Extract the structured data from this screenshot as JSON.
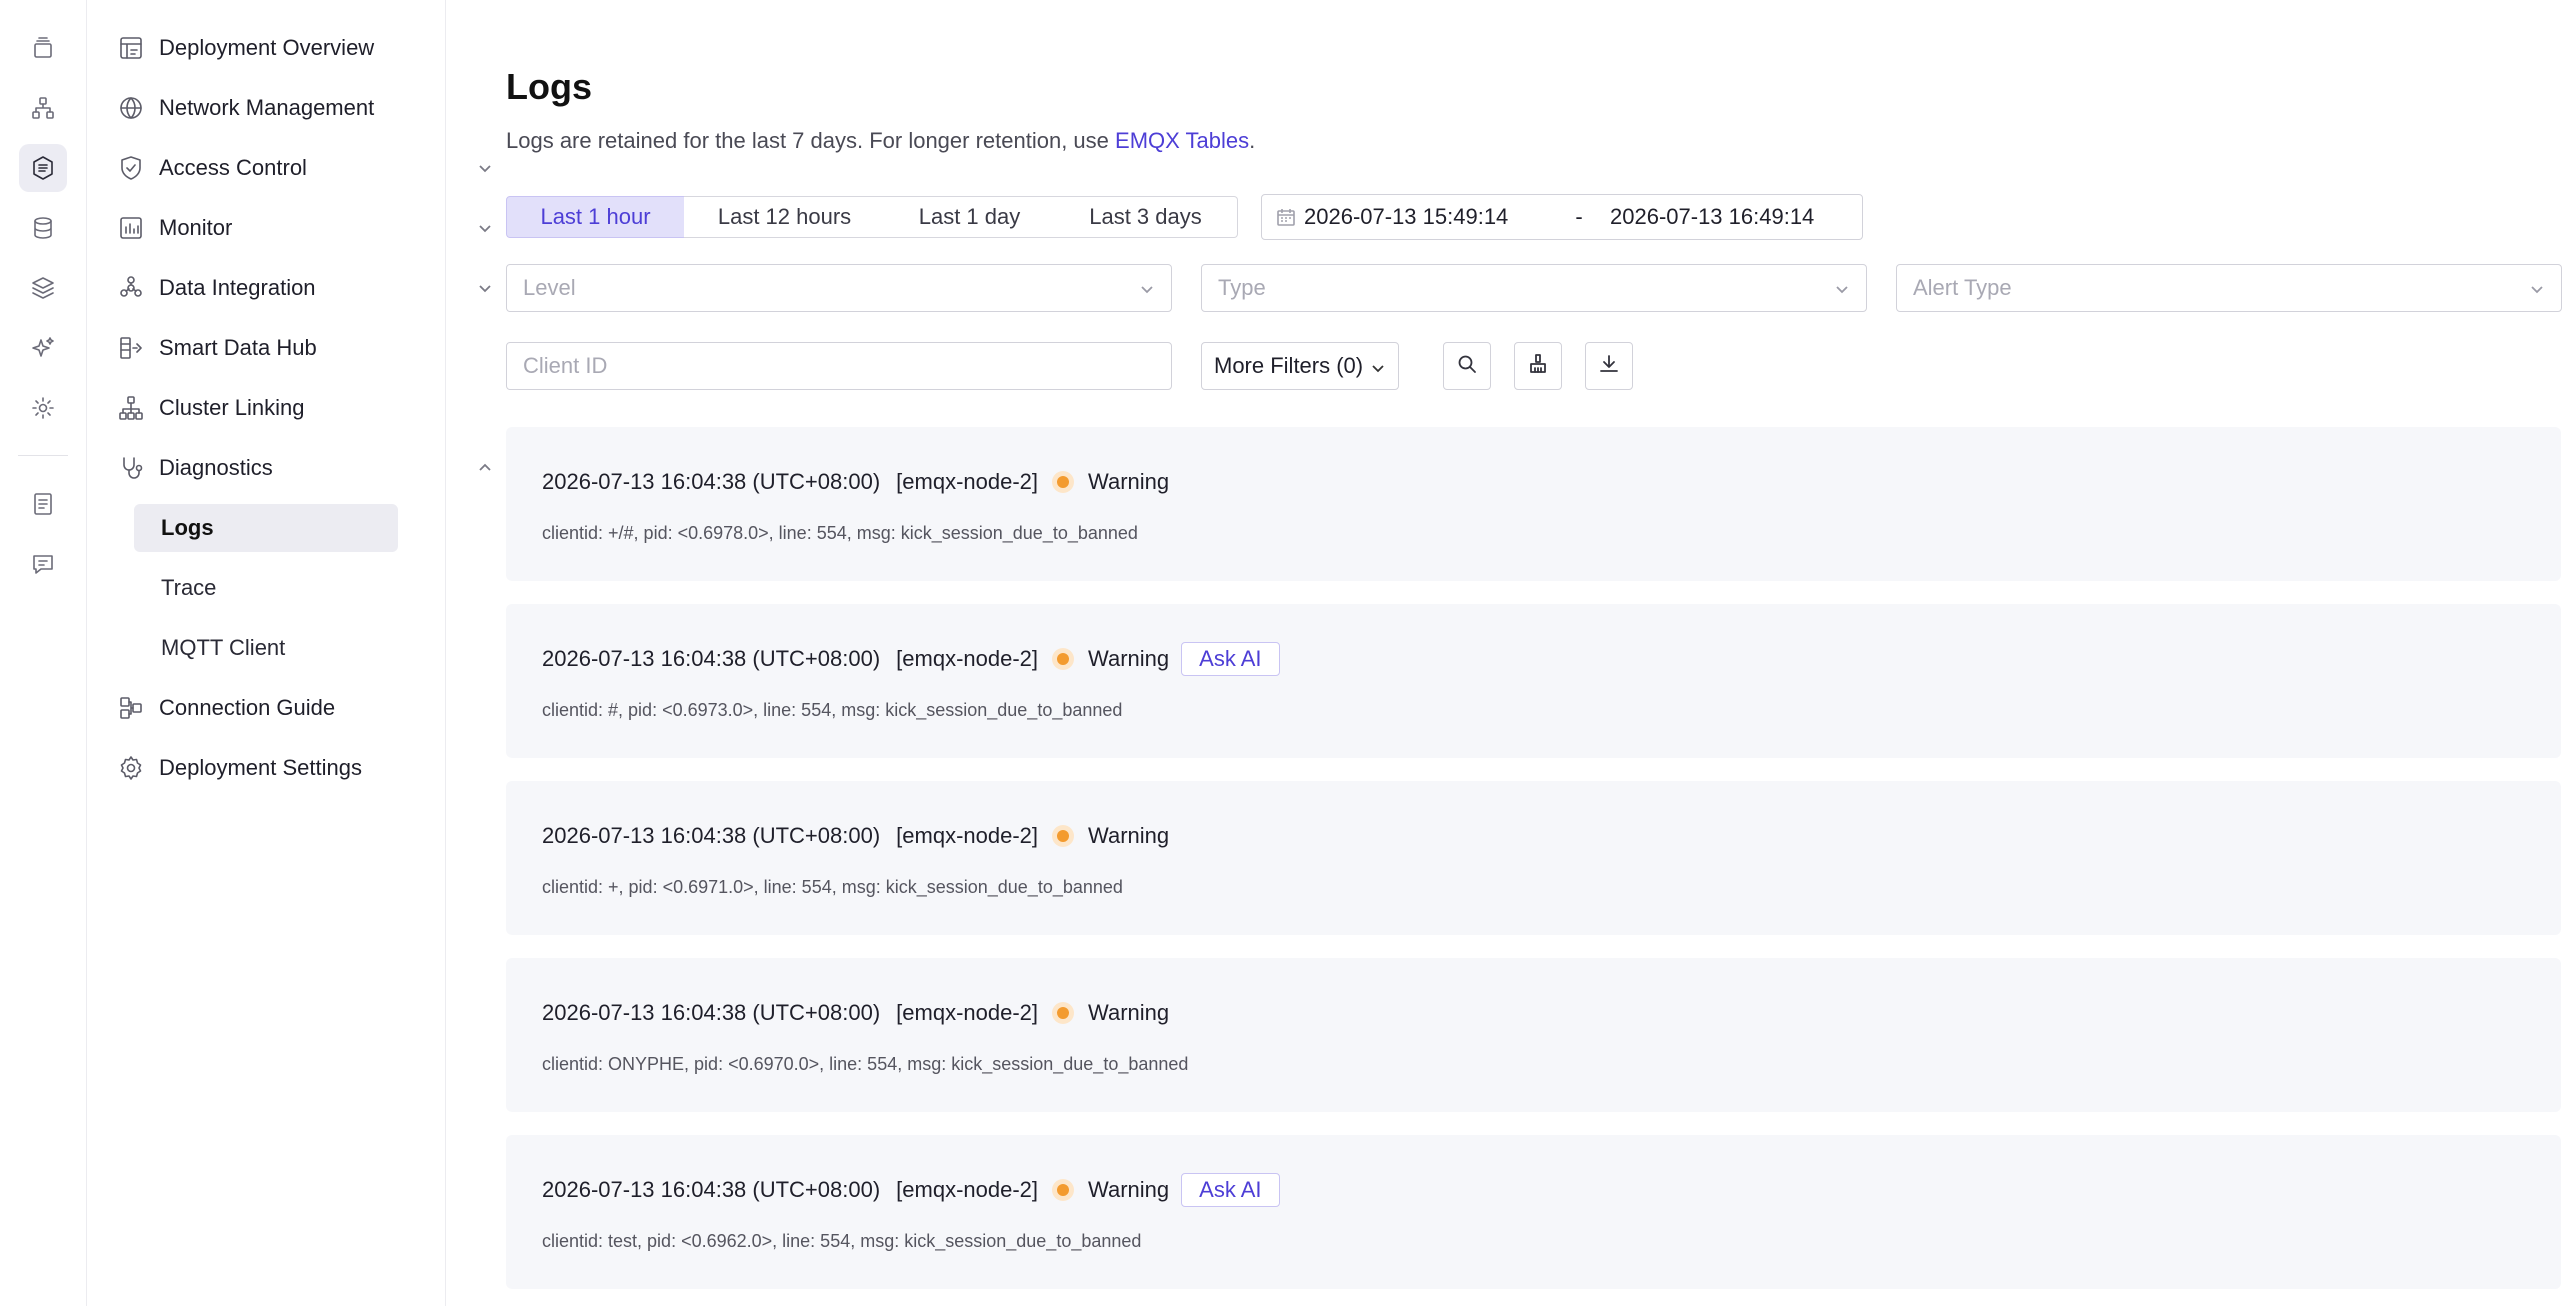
{
  "rail": {
    "icons": [
      "deployments-icon",
      "network-topology-icon",
      "logs-icon",
      "database-icon",
      "layers-icon",
      "ai-sparkle-icon",
      "settings-icon",
      "document-icon",
      "chat-icon"
    ]
  },
  "sidebar": {
    "items": [
      {
        "label": "Deployment Overview",
        "icon": "dashboard-icon"
      },
      {
        "label": "Network Management",
        "icon": "globe-icon"
      },
      {
        "label": "Access Control",
        "icon": "shield-icon"
      },
      {
        "label": "Monitor",
        "icon": "chart-icon"
      },
      {
        "label": "Data Integration",
        "icon": "integration-icon"
      },
      {
        "label": "Smart Data Hub",
        "icon": "data-hub-icon"
      },
      {
        "label": "Cluster Linking",
        "icon": "cluster-icon"
      },
      {
        "label": "Diagnostics",
        "icon": "stethoscope-icon"
      },
      {
        "label": "Connection Guide",
        "icon": "connection-icon"
      },
      {
        "label": "Deployment Settings",
        "icon": "gear-icon"
      }
    ],
    "diagnostics_sub": [
      {
        "label": "Logs"
      },
      {
        "label": "Trace"
      },
      {
        "label": "MQTT Client"
      }
    ]
  },
  "main": {
    "title": "Logs",
    "description": "Logs are retained for the last 7 days. For longer retention, use ",
    "description_link": "EMQX Tables",
    "description_end": ".",
    "time_ranges": [
      "Last 1 hour",
      "Last 12 hours",
      "Last 1 day",
      "Last 3 days"
    ],
    "selected_range": "Last 1 hour",
    "date_start": "2026-07-13 15:49:14",
    "date_sep": "-",
    "date_end": "2026-07-13 16:49:14",
    "filters": {
      "level_placeholder": "Level",
      "type_placeholder": "Type",
      "alert_type_placeholder": "Alert Type",
      "client_id_placeholder": "Client ID",
      "more_filters": "More Filters (0)"
    },
    "ask_ai_label": "Ask AI",
    "logs": [
      {
        "time": "2026-07-13 16:04:38 (UTC+08:00)",
        "node": "[emqx-node-2]",
        "level": "Warning",
        "ask_ai": false,
        "msg": "clientid: +/#, pid: <0.6978.0>, line: 554, msg: kick_session_due_to_banned"
      },
      {
        "time": "2026-07-13 16:04:38 (UTC+08:00)",
        "node": "[emqx-node-2]",
        "level": "Warning",
        "ask_ai": true,
        "msg": "clientid: #, pid: <0.6973.0>, line: 554, msg: kick_session_due_to_banned"
      },
      {
        "time": "2026-07-13 16:04:38 (UTC+08:00)",
        "node": "[emqx-node-2]",
        "level": "Warning",
        "ask_ai": false,
        "msg": "clientid: +, pid: <0.6971.0>, line: 554, msg: kick_session_due_to_banned"
      },
      {
        "time": "2026-07-13 16:04:38 (UTC+08:00)",
        "node": "[emqx-node-2]",
        "level": "Warning",
        "ask_ai": false,
        "msg": "clientid: ONYPHE, pid: <0.6970.0>, line: 554, msg: kick_session_due_to_banned"
      },
      {
        "time": "2026-07-13 16:04:38 (UTC+08:00)",
        "node": "[emqx-node-2]",
        "level": "Warning",
        "ask_ai": true,
        "msg": "clientid: test, pid: <0.6962.0>, line: 554, msg: kick_session_due_to_banned"
      }
    ],
    "colors": {
      "accent": "#4d3ed6",
      "warning": "#f39b2f"
    }
  }
}
